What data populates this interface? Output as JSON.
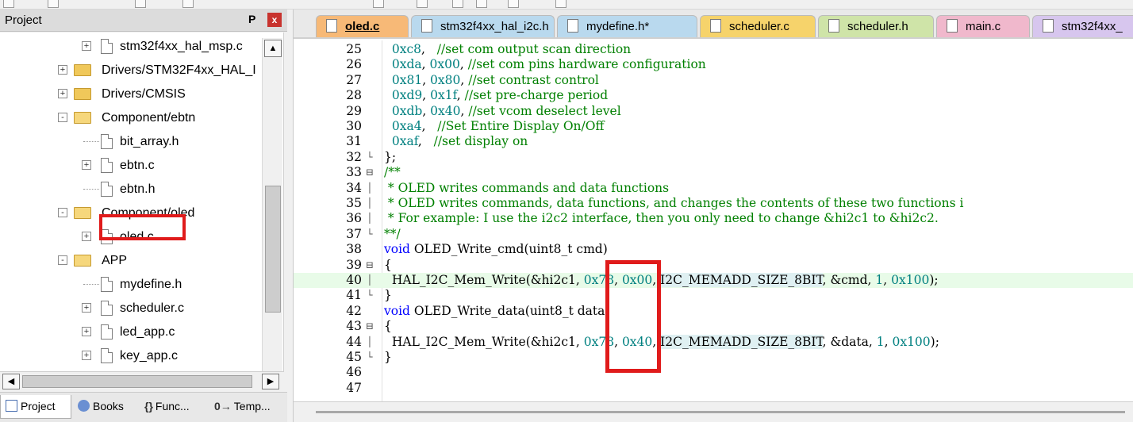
{
  "panel": {
    "title": "Project",
    "pin_glyph": "P",
    "close_glyph": "x",
    "tree": [
      {
        "label": "stm32f4xx_hal_msp.c",
        "type": "file",
        "expander": "+"
      },
      {
        "label": "Drivers/STM32F4xx_HAL_I",
        "type": "folder",
        "expander": "+"
      },
      {
        "label": "Drivers/CMSIS",
        "type": "folder",
        "expander": "+"
      },
      {
        "label": "Component/ebtn",
        "type": "folder-open",
        "expander": "-"
      },
      {
        "label": "bit_array.h",
        "type": "file",
        "expander": ""
      },
      {
        "label": "ebtn.c",
        "type": "file",
        "expander": "+"
      },
      {
        "label": "ebtn.h",
        "type": "file",
        "expander": ""
      },
      {
        "label": "Component/oled",
        "type": "folder-open",
        "expander": "-"
      },
      {
        "label": "oled.c",
        "type": "file",
        "expander": "+"
      },
      {
        "label": "APP",
        "type": "folder-open",
        "expander": "-"
      },
      {
        "label": "mydefine.h",
        "type": "file",
        "expander": ""
      },
      {
        "label": "scheduler.c",
        "type": "file",
        "expander": "+"
      },
      {
        "label": "led_app.c",
        "type": "file",
        "expander": "+"
      },
      {
        "label": "key_app.c",
        "type": "file",
        "expander": "+"
      }
    ],
    "scroll_up": "▲",
    "scroll_left": "◀",
    "scroll_right": "▶",
    "bottom_tabs": [
      {
        "label": "Project",
        "icon": "project-icon"
      },
      {
        "label": "Books",
        "icon": "books-icon"
      },
      {
        "label": "Func...",
        "icon": "functions-icon",
        "glyph": "{}"
      },
      {
        "label": "Temp...",
        "icon": "templates-icon",
        "glyph": "0→"
      }
    ]
  },
  "editor": {
    "tabs": [
      {
        "label": "oled.c",
        "color": "#f7b977",
        "active": true
      },
      {
        "label": "stm32f4xx_hal_i2c.h",
        "color": "#b9d9ee"
      },
      {
        "label": "mydefine.h*",
        "color": "#b9d9ee"
      },
      {
        "label": "scheduler.c",
        "color": "#f6d36b"
      },
      {
        "label": "scheduler.h",
        "color": "#cfe4a8"
      },
      {
        "label": "main.c",
        "color": "#f0b8cc"
      },
      {
        "label": "stm32f4xx_",
        "color": "#d7c6ee"
      }
    ],
    "lines": [
      {
        "num": "25",
        "fold": "",
        "code": "  0xc8,   //set com output scan direction"
      },
      {
        "num": "26",
        "fold": "",
        "code": "  0xda, 0x00, //set com pins hardware configuration"
      },
      {
        "num": "27",
        "fold": "",
        "code": "  0x81, 0x80, //set contrast control"
      },
      {
        "num": "28",
        "fold": "",
        "code": "  0xd9, 0x1f, //set pre-charge period"
      },
      {
        "num": "29",
        "fold": "",
        "code": "  0xdb, 0x40, //set vcom deselect level"
      },
      {
        "num": "30",
        "fold": "",
        "code": "  0xa4,   //Set Entire Display On/Off"
      },
      {
        "num": "31",
        "fold": "",
        "code": "  0xaf,   //set display on"
      },
      {
        "num": "32",
        "fold": "└",
        "code": "};"
      },
      {
        "num": "33",
        "fold": "⊟",
        "code": "/**"
      },
      {
        "num": "34",
        "fold": "│",
        "code": " * OLED writes commands and data functions"
      },
      {
        "num": "35",
        "fold": "│",
        "code": " * OLED writes commands, data functions, and changes the contents of these two functions i"
      },
      {
        "num": "36",
        "fold": "│",
        "code": " * For example: I use the i2c2 interface, then you only need to change &hi2c1 to &hi2c2."
      },
      {
        "num": "37",
        "fold": "└",
        "code": "**/"
      },
      {
        "num": "38",
        "fold": "",
        "code": "void OLED_Write_cmd(uint8_t cmd)"
      },
      {
        "num": "39",
        "fold": "⊟",
        "code": "{"
      },
      {
        "num": "40",
        "fold": "│",
        "code": "  HAL_I2C_Mem_Write(&hi2c1, 0x78, 0x00, I2C_MEMADD_SIZE_8BIT, &cmd, 1, 0x100);"
      },
      {
        "num": "41",
        "fold": "└",
        "code": "}"
      },
      {
        "num": "42",
        "fold": "",
        "code": "void OLED_Write_data(uint8_t data)"
      },
      {
        "num": "43",
        "fold": "⊟",
        "code": "{"
      },
      {
        "num": "44",
        "fold": "│",
        "code": "  HAL_I2C_Mem_Write(&hi2c1, 0x78, 0x40, I2C_MEMADD_SIZE_8BIT, &data, 1, 0x100);"
      },
      {
        "num": "45",
        "fold": "└",
        "code": "}"
      },
      {
        "num": "46",
        "fold": "",
        "code": ""
      },
      {
        "num": "47",
        "fold": "",
        "code": ""
      }
    ]
  },
  "colors": {
    "comment": "#008000",
    "keyword": "#0000ff",
    "number": "#008080",
    "highlight": "#e01b1b",
    "current_line": "#e8fbe8"
  }
}
